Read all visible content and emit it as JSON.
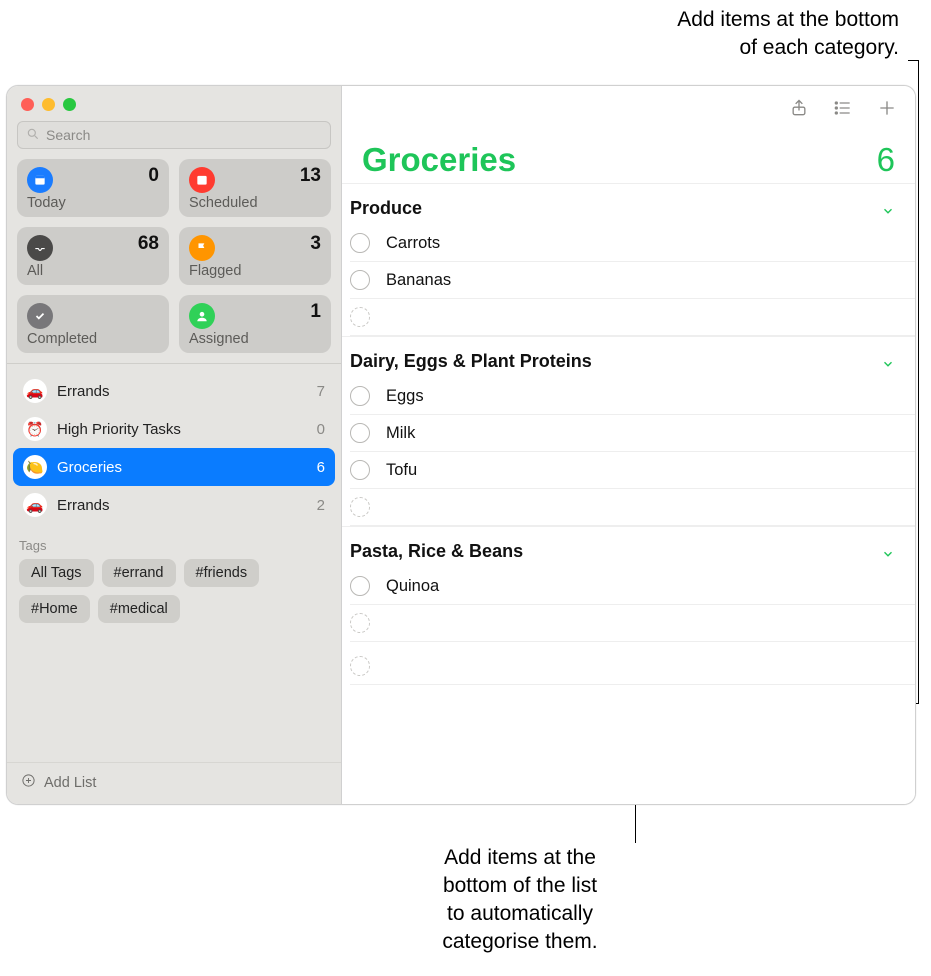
{
  "search": {
    "placeholder": "Search"
  },
  "smart": {
    "today": {
      "label": "Today",
      "count": "0"
    },
    "scheduled": {
      "label": "Scheduled",
      "count": "13"
    },
    "all": {
      "label": "All",
      "count": "68"
    },
    "flagged": {
      "label": "Flagged",
      "count": "3"
    },
    "completed": {
      "label": "Completed",
      "count": ""
    },
    "assigned": {
      "label": "Assigned",
      "count": "1"
    }
  },
  "lists": [
    {
      "emoji": "🚗",
      "name": "Errands",
      "count": "7",
      "selected": false
    },
    {
      "emoji": "⏰",
      "name": "High Priority Tasks",
      "count": "0",
      "selected": false
    },
    {
      "emoji": "🍋",
      "name": "Groceries",
      "count": "6",
      "selected": true
    },
    {
      "emoji": "🚗",
      "name": "Errands",
      "count": "2",
      "selected": false
    }
  ],
  "tagsHeader": "Tags",
  "tags": [
    "All Tags",
    "#errand",
    "#friends",
    "#Home",
    "#medical"
  ],
  "addList": "Add List",
  "main": {
    "title": "Groceries",
    "count": "6",
    "sections": [
      {
        "title": "Produce",
        "items": [
          "Carrots",
          "Bananas"
        ]
      },
      {
        "title": "Dairy, Eggs & Plant Proteins",
        "items": [
          "Eggs",
          "Milk",
          "Tofu"
        ]
      },
      {
        "title": "Pasta, Rice & Beans",
        "items": [
          "Quinoa"
        ]
      }
    ]
  },
  "annotations": {
    "top": "Add items at the bottom\nof each category.",
    "bottom": "Add items at the\nbottom of the list\nto automatically\ncategorise them."
  }
}
